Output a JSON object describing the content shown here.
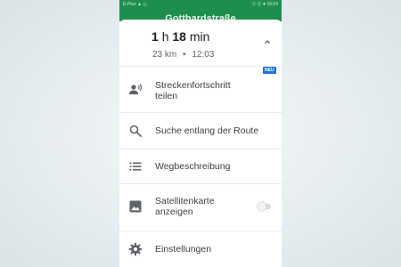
{
  "status_bar": {
    "left": "E-Plus ▲ ◻",
    "right": "ⓝ ⓓ ♥ 15:04"
  },
  "nav_banner": {
    "street": "Gotthardstraße"
  },
  "route_summary": {
    "duration_hours": "1",
    "duration_h_unit": "h",
    "duration_minutes": "18",
    "duration_min_unit": "min",
    "distance": "23 km",
    "separator": "•",
    "arrival_time": "12:03"
  },
  "menu": {
    "share_progress_label": "Streckenfortschritt teilen",
    "share_progress_badge": "NEU",
    "search_along_route_label": "Suche entlang der Route",
    "directions_label": "Wegbeschreibung",
    "satellite_label": "Satellitenkarte anzeigen",
    "satellite_enabled": false,
    "settings_label": "Einstellungen"
  },
  "colors": {
    "brand_green": "#1e8e4e",
    "badge_blue": "#1a73e8"
  },
  "icons": {
    "share_progress": "person-voice-icon",
    "search": "search-icon",
    "directions": "list-icon",
    "satellite": "image-icon",
    "settings": "gear-icon",
    "collapse": "chevron-up-icon"
  }
}
